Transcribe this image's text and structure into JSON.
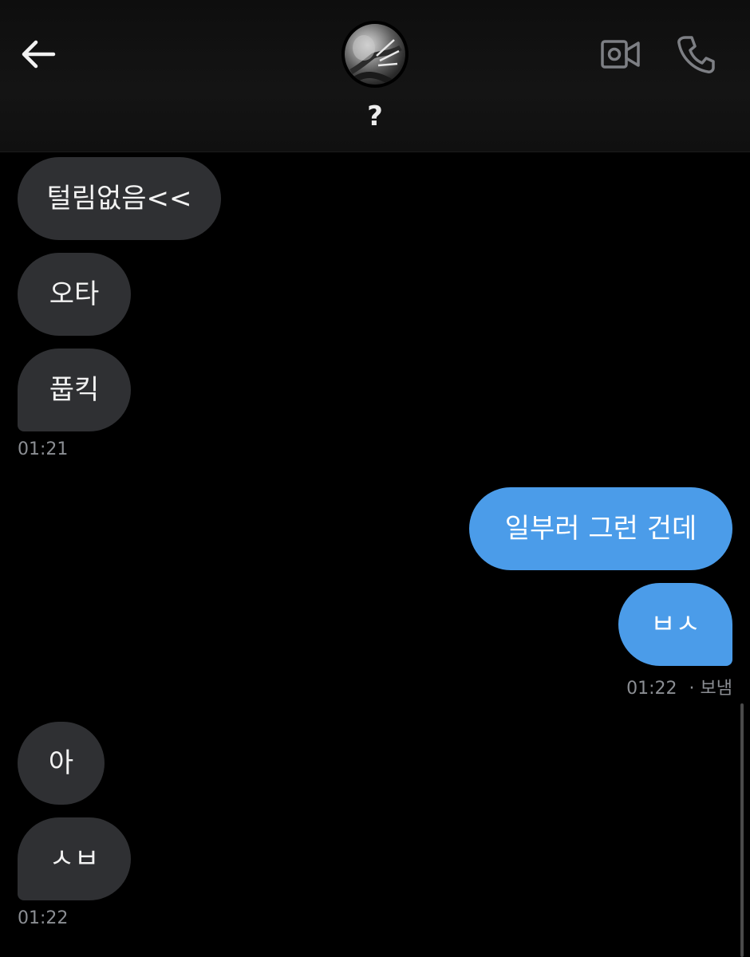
{
  "header": {
    "contact_name": "?",
    "icons": {
      "back": "arrow-left-icon",
      "video": "video-camera-icon",
      "phone": "phone-icon"
    }
  },
  "messages": [
    {
      "direction": "received",
      "text": "털림없음<<"
    },
    {
      "direction": "received",
      "text": "오타"
    },
    {
      "direction": "received",
      "text": "풉킥",
      "timestamp": "01:21"
    },
    {
      "direction": "sent",
      "text": "일부러 그런 건데"
    },
    {
      "direction": "sent",
      "text": "ㅂㅅ",
      "timestamp": "01:22",
      "status": "· 보냄"
    },
    {
      "direction": "received",
      "text": "아"
    },
    {
      "direction": "received",
      "text": "ㅅㅂ",
      "timestamp": "01:22"
    }
  ],
  "colors": {
    "background": "#000000",
    "received_bubble": "#2f3033",
    "sent_bubble": "#4b9ce9",
    "timestamp": "#8b8e93"
  }
}
